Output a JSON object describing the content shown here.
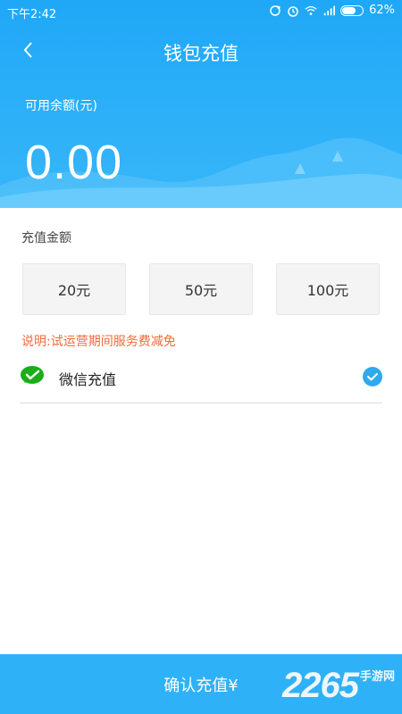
{
  "status_bar": {
    "time": "下午2:42",
    "battery": "62%",
    "icons": [
      "sync-icon",
      "alarm-icon",
      "wifi-icon",
      "hd-signal-icon",
      "battery-icon"
    ]
  },
  "header": {
    "title": "钱包充值",
    "back_icon": "chevron-left-icon"
  },
  "balance": {
    "label": "可用余额(元)",
    "value": "0.00"
  },
  "recharge": {
    "label": "充值金额",
    "options": [
      "20元",
      "50元",
      "100元"
    ]
  },
  "note": "说明:试运营期间服务费减免",
  "payment": {
    "label": "微信充值",
    "icon": "wechat-icon",
    "selected": true
  },
  "confirm": {
    "label": "确认充值¥"
  },
  "watermark": {
    "number": "2265",
    "text": "手游网"
  },
  "colors": {
    "primary": "#2fb1f7",
    "note": "#f06b3c",
    "check": "#2fa9ee",
    "wechat": "#1aad19"
  }
}
